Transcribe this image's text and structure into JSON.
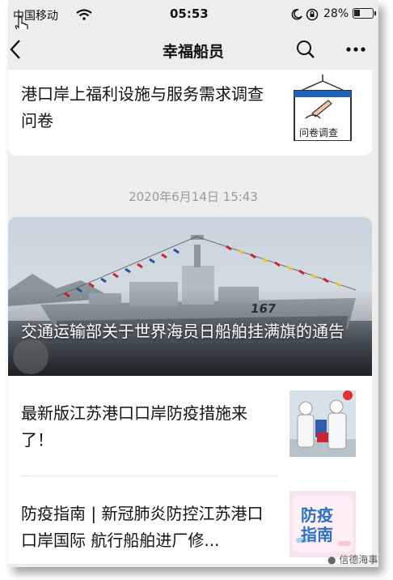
{
  "status_bar": {
    "carrier": "中国移动",
    "time": "05:53",
    "battery": "28%",
    "battery_level": 0.28
  },
  "nav": {
    "title": "幸福船员"
  },
  "articles": [
    {
      "title": "港口岸上福利设施与服务需求调查问卷",
      "thumb_text": "问卷调查"
    },
    {
      "title": "交通运输部关于世界海员日船舶挂满旗的通告"
    },
    {
      "title": "最新版江苏港口口岸防疫措施来了！"
    },
    {
      "title": "防疫指南 | 新冠肺炎防控江苏港口口岸国际 航行船舶进厂修...",
      "thumb_text": [
        "防疫",
        "指南"
      ]
    }
  ],
  "date_header": "2020年6月14日 15:43",
  "hero_ship_number": "167",
  "watermark": "信德海事",
  "colors": {
    "background": "#ededed",
    "card": "#ffffff",
    "text": "#111111",
    "muted": "#9a9a9a"
  }
}
